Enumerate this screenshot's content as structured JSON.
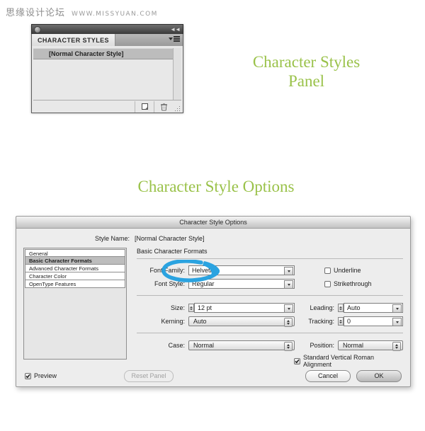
{
  "watermark": {
    "site_cn": "思缘设计论坛",
    "site_url": "WWW.MISSYUAN.COM"
  },
  "headings": {
    "panel": "Character Styles\nPanel",
    "panel_line1": "Character Styles",
    "panel_line2": "Panel",
    "options": "Character Style Options",
    "color": "#9ac24a"
  },
  "character_styles_panel": {
    "tab_label": "CHARACTER STYLES",
    "collapse_icon": "double-left-chevron-icon",
    "menu_icon": "panel-menu-icon",
    "styles": [
      {
        "name": "[Normal Character Style]",
        "selected": true
      }
    ],
    "footer_buttons": [
      {
        "name": "new-style-button",
        "icon": "new-page-icon"
      },
      {
        "name": "delete-style-button",
        "icon": "trash-icon"
      }
    ],
    "resize_grip": "resize-grip-icon"
  },
  "dialog": {
    "title": "Character Style Options",
    "style_name_label": "Style Name:",
    "style_name_value": "[Normal Character Style]",
    "categories": [
      {
        "label": "General",
        "selected": false
      },
      {
        "label": "Basic Character Formats",
        "selected": true
      },
      {
        "label": "Advanced Character Formats",
        "selected": false
      },
      {
        "label": "Character Color",
        "selected": false
      },
      {
        "label": "OpenType Features",
        "selected": false
      }
    ],
    "section_title": "Basic Character Formats",
    "fields": {
      "font_family_label": "Font Family:",
      "font_family_value": "Helvetica",
      "font_style_label": "Font Style:",
      "font_style_value": "Regular",
      "size_label": "Size:",
      "size_value": "12 pt",
      "leading_label": "Leading:",
      "leading_value": "Auto",
      "kerning_label": "Kerning:",
      "kerning_value": "Auto",
      "tracking_label": "Tracking:",
      "tracking_value": "0",
      "case_label": "Case:",
      "case_value": "Normal",
      "position_label": "Position:",
      "position_value": "Normal"
    },
    "checkboxes": {
      "underline": {
        "label": "Underline",
        "checked": false
      },
      "strikethrough": {
        "label": "Strikethrough",
        "checked": false
      },
      "vertical_roman": {
        "label": "Standard Vertical Roman Alignment",
        "checked": true
      },
      "preview": {
        "label": "Preview",
        "checked": true
      }
    },
    "buttons": {
      "reset_panel": "Reset Panel",
      "cancel": "Cancel",
      "ok": "OK"
    }
  },
  "annotation": {
    "type": "hand-drawn-ellipse",
    "color": "#2ba3e0",
    "target": "font-family-field"
  }
}
